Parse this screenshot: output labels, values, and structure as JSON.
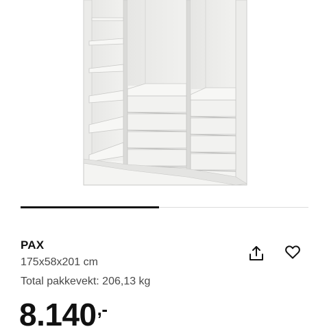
{
  "product": {
    "name": "PAX",
    "dimensions": "175x58x201 cm",
    "weight": "Total pakkevekt: 206,13 kg",
    "price_integer": "8.140",
    "price_suffix": ",-"
  },
  "image": {
    "alt_icon": "wardrobe-product-image"
  },
  "carousel": {
    "progress": 0.48
  },
  "icons": {
    "share": "share-icon",
    "favourite": "heart-icon"
  },
  "colors": {
    "text": "#111111",
    "secondary_text": "#484848",
    "track": "#dcdcdc",
    "progress": "#111111"
  }
}
